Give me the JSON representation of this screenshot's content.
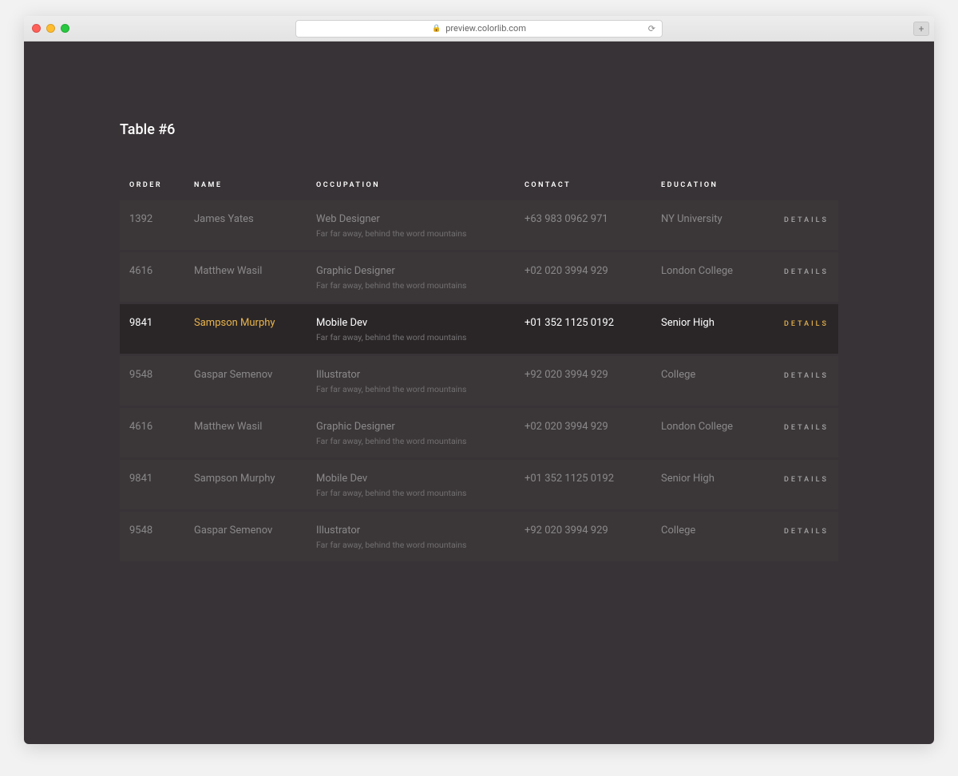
{
  "browser": {
    "url_display": "preview.colorlib.com"
  },
  "page": {
    "title": "Table #6"
  },
  "table": {
    "headers": {
      "order": "Order",
      "name": "Name",
      "occupation": "Occupation",
      "contact": "Contact",
      "education": "Education"
    },
    "details_label": "Details",
    "occupation_subtext": "Far far away, behind the word mountains",
    "active_row_index": 2,
    "rows": [
      {
        "order": "1392",
        "name": "James Yates",
        "occupation": "Web Designer",
        "contact": "+63 983 0962 971",
        "education": "NY University"
      },
      {
        "order": "4616",
        "name": "Matthew Wasil",
        "occupation": "Graphic Designer",
        "contact": "+02 020 3994 929",
        "education": "London College"
      },
      {
        "order": "9841",
        "name": "Sampson Murphy",
        "occupation": "Mobile Dev",
        "contact": "+01 352 1125 0192",
        "education": "Senior High"
      },
      {
        "order": "9548",
        "name": "Gaspar Semenov",
        "occupation": "Illustrator",
        "contact": "+92 020 3994 929",
        "education": "College"
      },
      {
        "order": "4616",
        "name": "Matthew Wasil",
        "occupation": "Graphic Designer",
        "contact": "+02 020 3994 929",
        "education": "London College"
      },
      {
        "order": "9841",
        "name": "Sampson Murphy",
        "occupation": "Mobile Dev",
        "contact": "+01 352 1125 0192",
        "education": "Senior High"
      },
      {
        "order": "9548",
        "name": "Gaspar Semenov",
        "occupation": "Illustrator",
        "contact": "+92 020 3994 929",
        "education": "College"
      }
    ]
  }
}
